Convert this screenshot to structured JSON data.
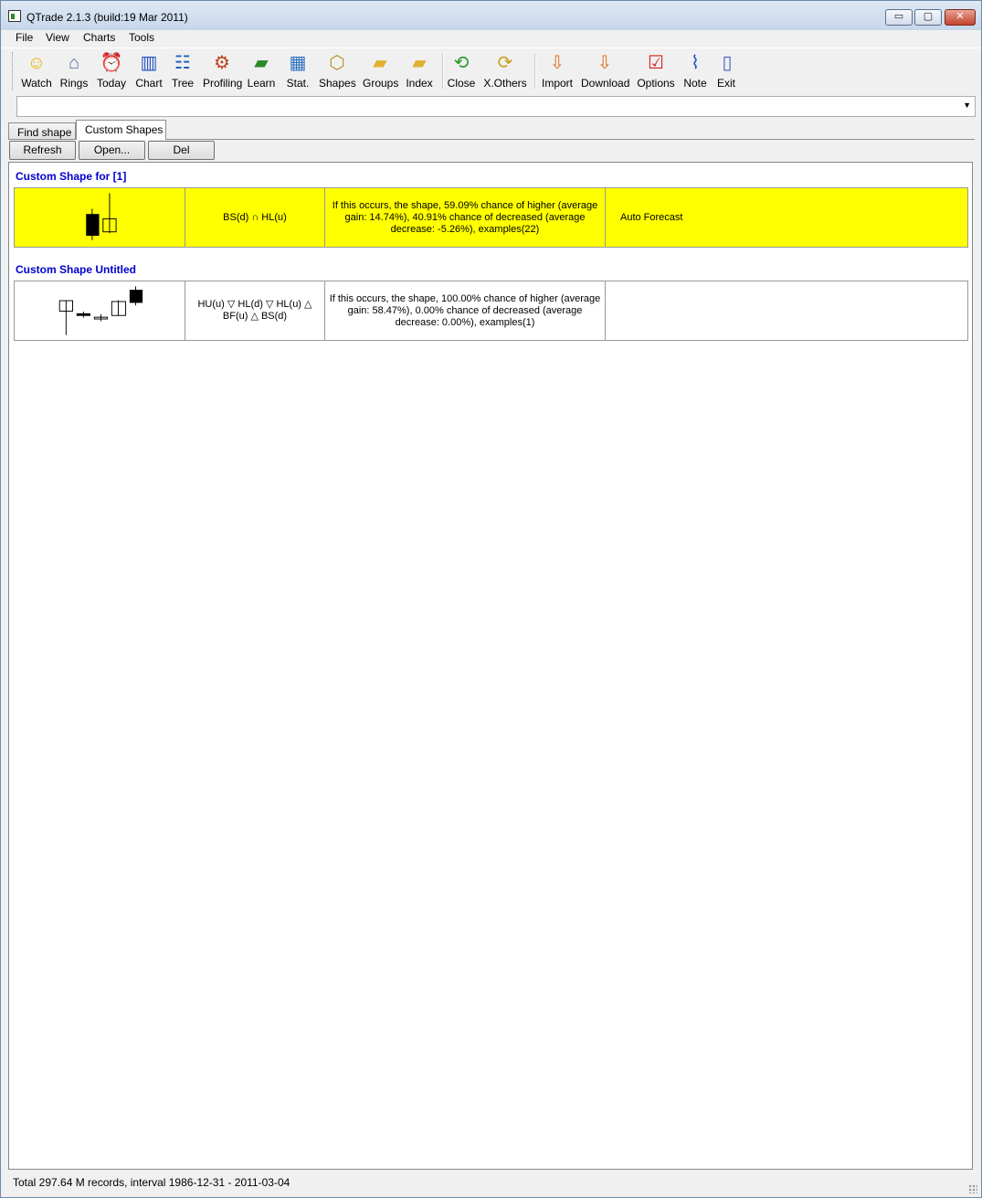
{
  "window": {
    "title": "QTrade 2.1.3 (build:19 Mar 2011)",
    "controls": {
      "minimize": "▭",
      "maximize": "▢",
      "close": "✕"
    }
  },
  "menu": [
    "File",
    "View",
    "Charts",
    "Tools"
  ],
  "toolbar": [
    {
      "label": "Watch",
      "icon": "smiley-icon",
      "glyph": "☺",
      "color": "#e8b400"
    },
    {
      "label": "Rings",
      "icon": "house-icon",
      "glyph": "⌂",
      "color": "#556fa0"
    },
    {
      "label": "Today",
      "icon": "alarm-clock-icon",
      "glyph": "⏰",
      "color": "#d02010"
    },
    {
      "label": "Chart",
      "icon": "bar-chart-icon",
      "glyph": "▥",
      "color": "#2050c0"
    },
    {
      "label": "Tree",
      "icon": "tree-icon",
      "glyph": "☷",
      "color": "#2060c0"
    },
    {
      "label": "Profiling",
      "icon": "profiling-icon",
      "glyph": "⚙",
      "color": "#c04020"
    },
    {
      "label": "Learn",
      "icon": "book-icon",
      "glyph": "▰",
      "color": "#2a8a2a"
    },
    {
      "label": "Stat.",
      "icon": "statistics-icon",
      "glyph": "▦",
      "color": "#3070c0"
    },
    {
      "label": "Shapes",
      "icon": "shapes-icon",
      "glyph": "⬡",
      "color": "#b89020"
    },
    {
      "label": "Groups",
      "icon": "folder-icon",
      "glyph": "▰",
      "color": "#e0b030"
    },
    {
      "label": "Index",
      "icon": "folder-icon",
      "glyph": "▰",
      "color": "#e0b030"
    },
    {
      "label": "Close",
      "icon": "close-refresh-icon",
      "glyph": "⟲",
      "color": "#2a9a2a"
    },
    {
      "label": "X.Others",
      "icon": "others-icon",
      "glyph": "⟳",
      "color": "#c8a020"
    },
    {
      "label": "Import",
      "icon": "import-icon",
      "glyph": "⇩",
      "color": "#e07020"
    },
    {
      "label": "Download",
      "icon": "download-icon",
      "glyph": "⇩",
      "color": "#e07020"
    },
    {
      "label": "Options",
      "icon": "checklist-icon",
      "glyph": "☑",
      "color": "#d02020"
    },
    {
      "label": "Note",
      "icon": "paperclip-icon",
      "glyph": "⌇",
      "color": "#2050c0"
    },
    {
      "label": "Exit",
      "icon": "exit-door-icon",
      "glyph": "▯",
      "color": "#4060c0"
    }
  ],
  "combo": {
    "value": "",
    "arrow": "▼"
  },
  "tabs": [
    "Find shape",
    "Custom Shapes"
  ],
  "buttons": {
    "refresh": "Refresh",
    "open": "Open...",
    "del": "Del"
  },
  "shapes": [
    {
      "title": "Custom Shape for [1]",
      "highlight": "#ffff00",
      "pattern": "BS(d) ∩ HL(u)",
      "description": "If this occurs, the shape, 59.09% chance of higher (average gain: 14.74%), 40.91% chance of decreased (average decrease: -5.26%), examples(22)",
      "action": "Auto Forecast"
    },
    {
      "title": "Custom Shape Untitled",
      "highlight": "#ffffff",
      "pattern": "HU(u) ▽ HL(d) ▽ HL(u) △ BF(u) △ BS(d)",
      "description": "If this occurs, the shape, 100.00% chance of higher (average gain: 58.47%), 0.00% chance of decreased (average decrease: 0.00%), examples(1)",
      "action": ""
    }
  ],
  "status": "Total 297.64 M records, interval 1986-12-31 - 2011-03-04"
}
